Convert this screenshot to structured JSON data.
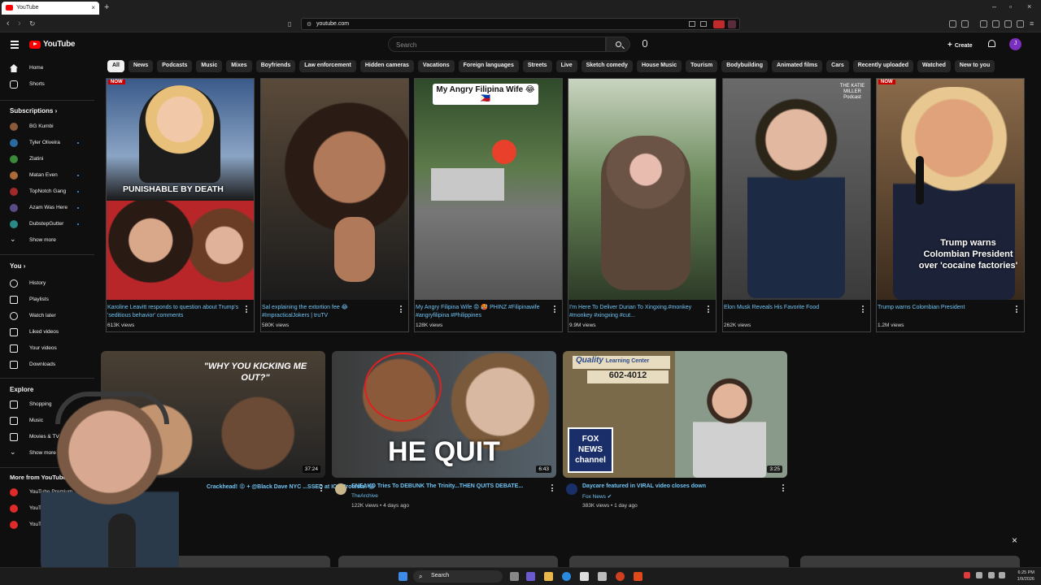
{
  "browser": {
    "tab_title": "YouTube",
    "url": "youtube.com"
  },
  "header": {
    "logo_text": "YouTube",
    "search_placeholder": "Search",
    "create_label": "Create",
    "avatar_letter": "J"
  },
  "chips": [
    "All",
    "News",
    "Podcasts",
    "Music",
    "Mixes",
    "Boyfriends",
    "Law enforcement",
    "Hidden cameras",
    "Vacations",
    "Foreign languages",
    "Streets",
    "Live",
    "Sketch comedy",
    "House Music",
    "Tourism",
    "Bodybuilding",
    "Animated films",
    "Cars",
    "Recently uploaded",
    "Watched",
    "New to you"
  ],
  "sidebar": {
    "home": "Home",
    "shorts": "Shorts",
    "subscriptions_heading": "Subscriptions",
    "subscriptions": [
      "BG Kumbi",
      "Tyler Oliveira",
      "Zlatini",
      "Matan Even",
      "TopNotch Gang",
      "Azam Was Here",
      "DubstepGutter"
    ],
    "show_more": "Show more",
    "you_heading": "You",
    "you_items": [
      "History",
      "Playlists",
      "Watch later",
      "Liked videos",
      "Your videos",
      "Downloads"
    ],
    "explore_heading": "Explore",
    "explore_items": [
      "Shopping",
      "Music",
      "Movies & TV"
    ],
    "show_more_2": "Show more",
    "more_heading": "More from YouTube",
    "more_items": [
      "YouTube Premium",
      "YouTube Studio",
      "YouTube Music"
    ]
  },
  "shorts": [
    {
      "title": "Karoline Leavitt responds to question about Trump's 'seditious behavior' comments",
      "views": "613K views",
      "overlay": "PUNISHABLE BY DEATH",
      "badge": "NOW"
    },
    {
      "title": "Sal explaining the extortion fee 😂 #ImpracticalJokers | truTV",
      "views": "580K views"
    },
    {
      "title": "My Angry Filipina Wife 😡 🥵 PHINZ #Filipinawife #angryfilipina #Philippines",
      "views": "128K views",
      "overlay": "My Angry Filipina Wife 😂🇵🇭"
    },
    {
      "title": "I'm Here To Deliver Durian To Xingxing.#monkey #monkey #xingxing #cut...",
      "views": "9.9M views"
    },
    {
      "title": "Elon Musk Reveals His Favorite Food",
      "views": "262K views",
      "overlay": "THE KATIE MILLER Podcast"
    },
    {
      "title": "Trump warns Colombian President",
      "views": "1.2M views",
      "overlay": "Trump warns Colombian President over 'cocaine factories'",
      "badge": "NOW"
    }
  ],
  "videos": [
    {
      "title": "Crackhead! 😡 + @Black Dave NYC ...SSED at ICE Protests! 😱",
      "channel": "",
      "meta": "",
      "duration": "37:24",
      "overlay": "\"WHY YOU KICKING ME OUT?\""
    },
    {
      "title": "SNEAKO Tries To DEBUNK The Trinity...THEN QUITS DEBATE...",
      "channel": "TheArchive",
      "meta": "122K views • 4 days ago",
      "duration": "6:43",
      "overlay": "HE QUIT"
    },
    {
      "title": "Daycare featured in VIRAL video closes down",
      "channel": "Fox News ✔",
      "meta": "383K views • 1 day ago",
      "duration": "3:25",
      "overlay": "FOX NEWS channel",
      "sign": "Quality",
      "sign2": "Learning Center",
      "phone": "602-4012"
    }
  ],
  "taskbar": {
    "search_label": "Search",
    "time": "6:25 PM",
    "date": "1/9/2026"
  },
  "colors": {
    "accent": "#3ea6ff",
    "brand": "#ff0000",
    "bg": "#0f0f0f"
  }
}
